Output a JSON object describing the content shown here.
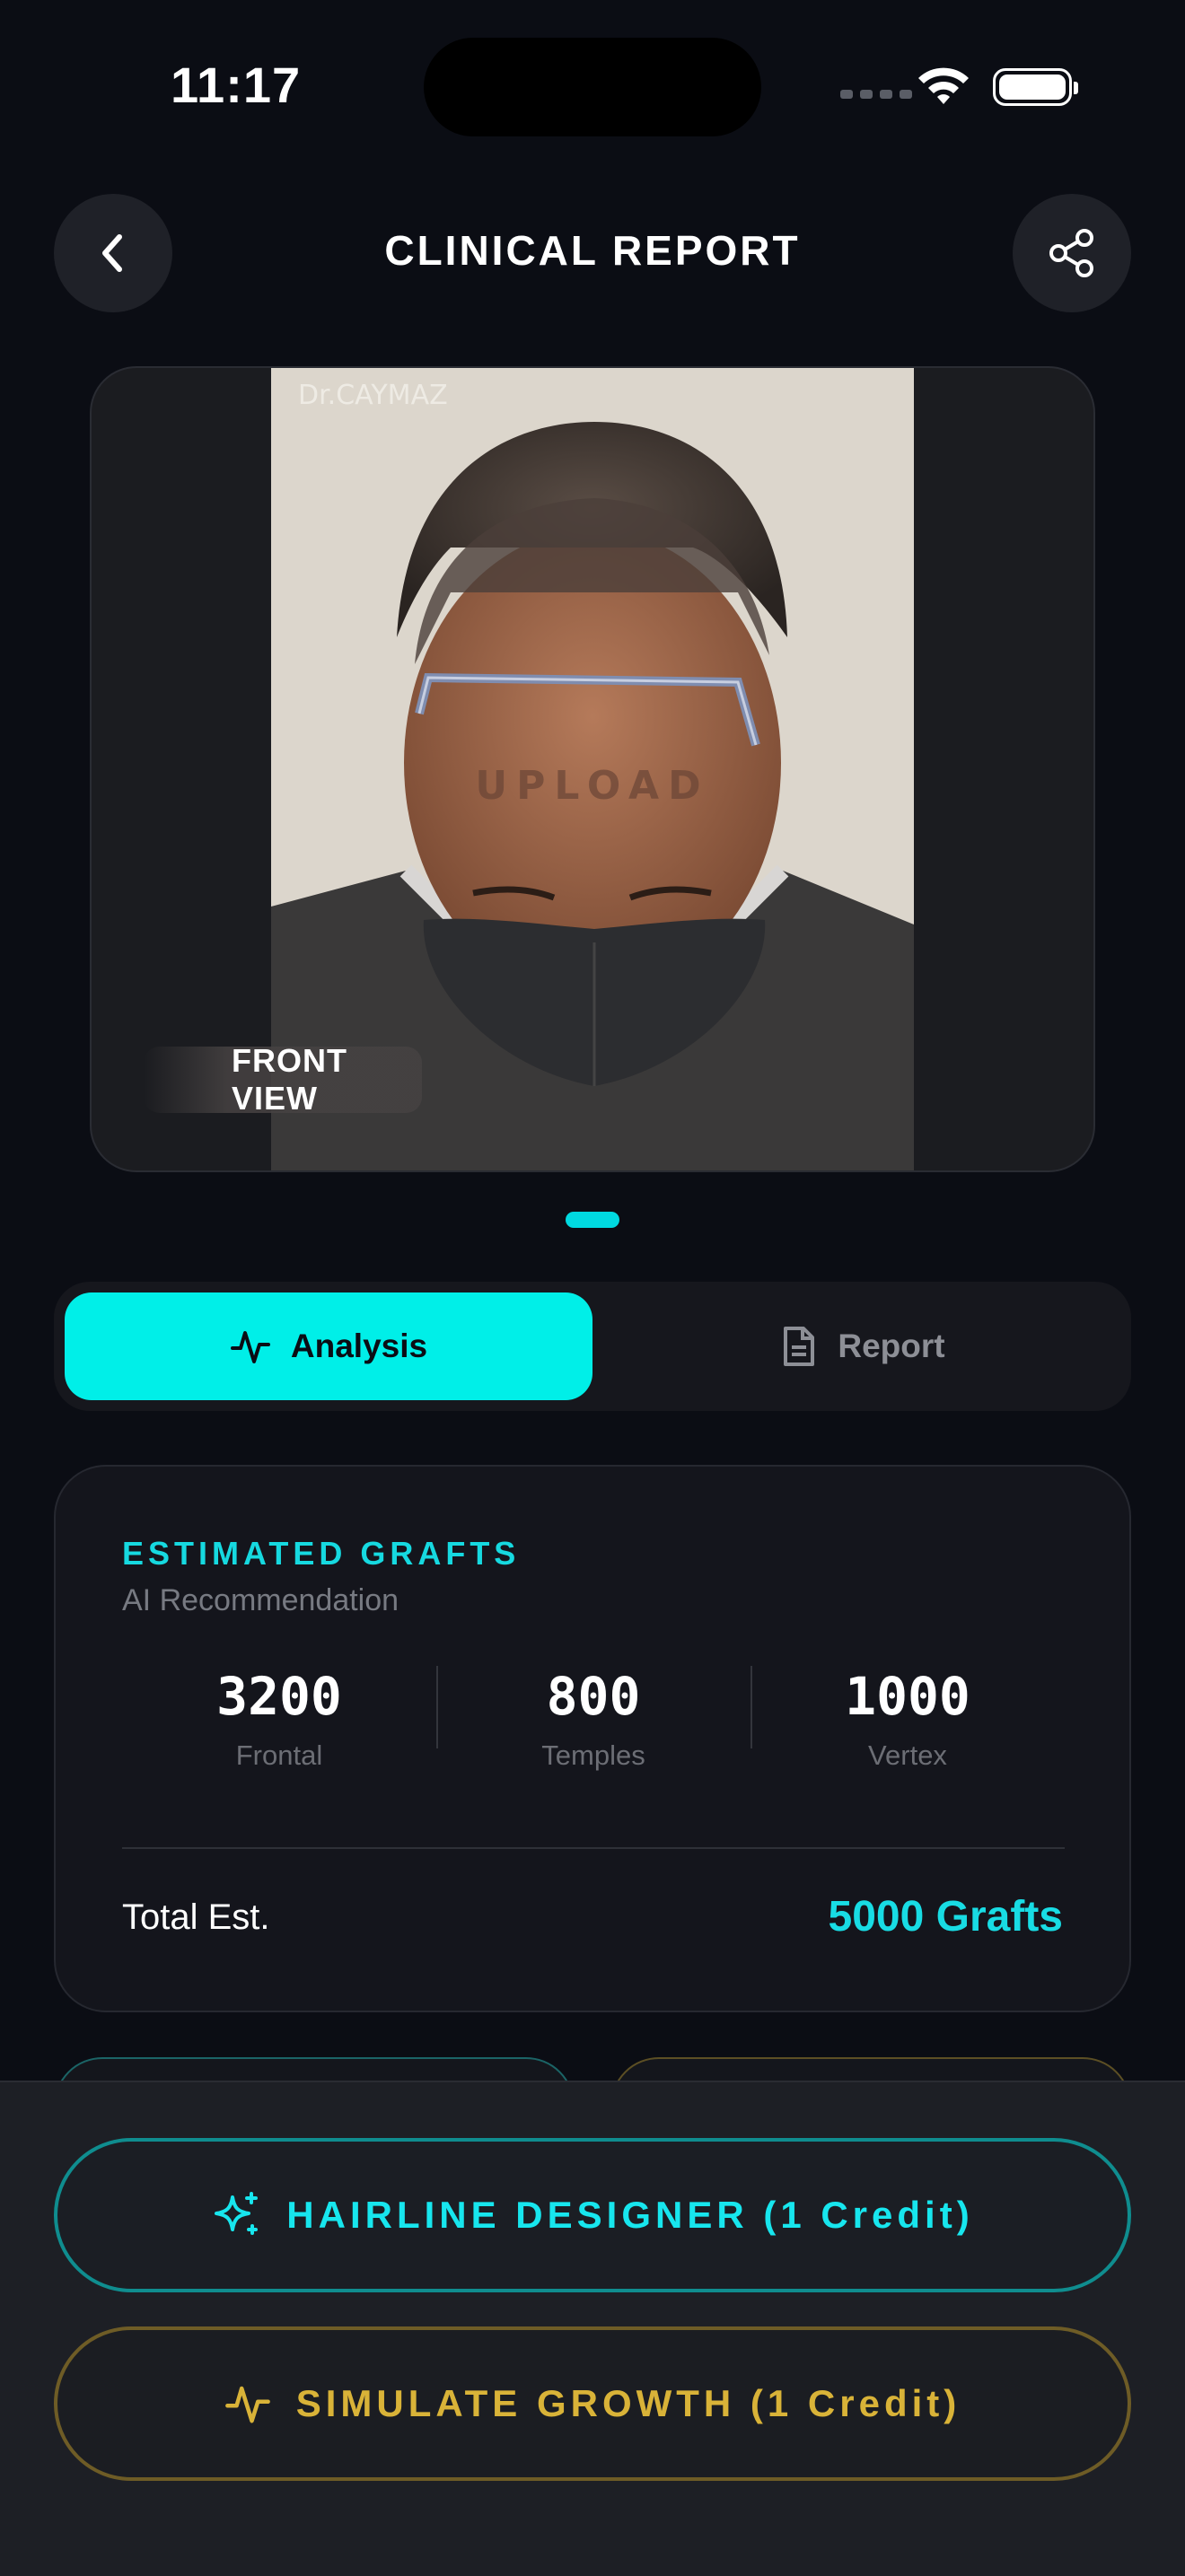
{
  "status_bar": {
    "time": "11:17"
  },
  "header": {
    "title": "CLINICAL REPORT"
  },
  "photo": {
    "watermark": "Dr.CAYMAZ",
    "view_label": "FRONT VIEW",
    "page_count": 1,
    "current_page": 1
  },
  "tabs": [
    {
      "label": "Analysis",
      "icon": "activity-icon",
      "selected": true
    },
    {
      "label": "Report",
      "icon": "document-icon",
      "selected": false
    }
  ],
  "grafts_card": {
    "label": "ESTIMATED GRAFTS",
    "sublabel": "AI Recommendation",
    "stats": [
      {
        "value": "3200",
        "label": "Frontal"
      },
      {
        "value": "800",
        "label": "Temples"
      },
      {
        "value": "1000",
        "label": "Vertex"
      }
    ],
    "total_label": "Total Est.",
    "total_value": "5000 Grafts"
  },
  "actions": {
    "hairline": {
      "label": "HAIRLINE DESIGNER (1 Credit)",
      "icon": "sparkle-icon"
    },
    "growth": {
      "label": "SIMULATE GROWTH (1 Credit)",
      "icon": "activity-icon"
    }
  },
  "colors": {
    "accent": "#00efe8",
    "gold": "#d9b338",
    "background": "#0b0d14"
  }
}
